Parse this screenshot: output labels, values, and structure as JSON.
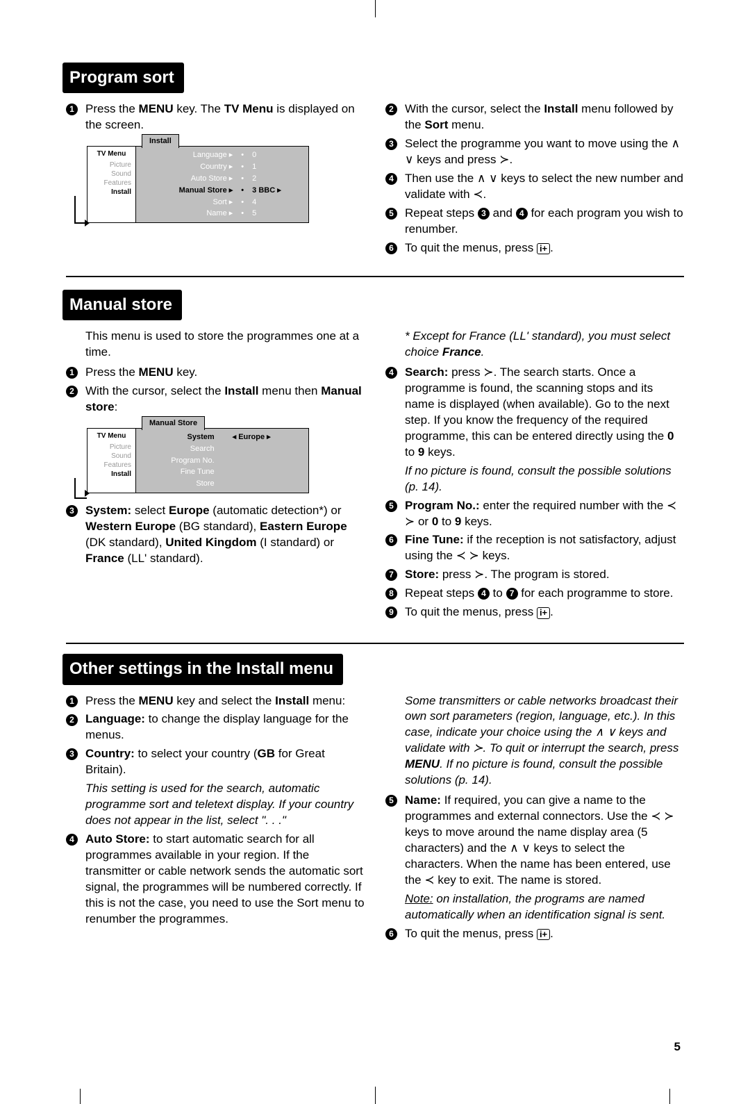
{
  "page_number": "5",
  "sections": {
    "program_sort": {
      "title": "Program sort",
      "col1": {
        "step1": "Press the <b>MENU</b> key. The <b>TV Menu</b> is displayed on the screen."
      },
      "diagram1": {
        "left_title": "TV Menu",
        "left_items": [
          "Picture",
          "Sound",
          "Features",
          "Install"
        ],
        "left_active_index": 3,
        "right_title": "Install",
        "rows": [
          {
            "label": "Language",
            "val": "0"
          },
          {
            "label": "Country",
            "val": "1"
          },
          {
            "label": "Auto Store",
            "val": "2"
          },
          {
            "label": "Manual Store",
            "val": "3  BBC  ▸",
            "active": true
          },
          {
            "label": "Sort",
            "val": "4"
          },
          {
            "label": "Name",
            "val": "5"
          }
        ]
      },
      "col2": {
        "step2": "With the cursor, select the <b>Install</b> menu followed by the <b>Sort</b> menu.",
        "step3": "Select the programme you want to move using the ∧ ∨ keys and press ≻.",
        "step4": "Then use the ∧ ∨ keys to select the new number and validate with ≺.",
        "step5i": "Repeat steps ",
        "step5m": " and ",
        "step5e": " for each program you wish to renumber.",
        "step6a": "To quit the menus, press ",
        "step6b": "."
      }
    },
    "manual_store": {
      "title": "Manual store",
      "intro": "This menu is used to store the programmes one at a time.",
      "col1": {
        "step1": "Press the <b>MENU</b> key.",
        "step2": "With the cursor, select the <b>Install</b> menu then <b>Manual store</b>:"
      },
      "diagram2": {
        "left_title": "TV Menu",
        "left_items": [
          "Picture",
          "Sound",
          "Features",
          "Install"
        ],
        "left_active_index": 3,
        "right_title": "Manual Store",
        "rows": [
          {
            "label": "System",
            "val": "◂  Europe  ▸",
            "active": true
          },
          {
            "label": "Search",
            "val": ""
          },
          {
            "label": "Program No.",
            "val": ""
          },
          {
            "label": "Fine Tune",
            "val": ""
          },
          {
            "label": "Store",
            "val": ""
          }
        ]
      },
      "step3": "<b>System:</b> select <b>Europe</b> (automatic detection*) or <b>Western Europe</b> (BG standard), <b>Eastern Europe</b> (DK standard), <b>United Kingdom</b> (I standard) or <b>France</b> (LL' standard).",
      "col2": {
        "note_star": "* Except for France (LL' standard), you must select choice <b>France</b>.",
        "step4": "<b>Search:</b> press ≻. The search starts. Once a programme is found, the scanning stops and its name is displayed (when available). Go to the next step. If you know the frequency of the required programme, this can be entered directly using the <b>0</b> to <b>9</b> keys.",
        "note4": "If no picture is found, consult the possible solutions (p. 14).",
        "step5": "<b>Program No.:</b> enter the required number with the ≺ ≻ or <b>0</b> to <b>9</b> keys.",
        "step6": "<b>Fine Tune:</b> if the reception is not satisfactory, adjust using the ≺ ≻ keys.",
        "step7": "<b>Store:</b> press ≻. The program is stored.",
        "step8a": "Repeat steps ",
        "step8b": " to ",
        "step8c": " for each programme to store.",
        "step9a": "To quit the menus, press ",
        "step9b": "."
      }
    },
    "other": {
      "title": "Other settings in the Install menu",
      "col1": {
        "step1": "Press the <b>MENU</b> key and select the <b>Install</b> menu:",
        "step2": "<b>Language:</b> to change the display language for the menus.",
        "step3": "<b>Country:</b> to select your country (<b>GB</b> for Great Britain).",
        "note3": "This setting is used for the search, automatic programme sort and teletext display. If your country does not appear in the list, select \". . .\"",
        "step4": "<b>Auto Store:</b> to start automatic search for all programmes available in your region. If the transmitter or cable network sends the automatic sort signal, the programmes will be numbered correctly. If this is not the case, you need to use the Sort menu to renumber the programmes."
      },
      "col2": {
        "note_top": "Some transmitters or cable networks broadcast their own sort parameters (region, language, etc.). In this case, indicate your choice using the ∧ ∨ keys and validate with ≻. To quit or interrupt the search, press <b>MENU</b>. If no picture is found, consult the possible solutions (p. 14).",
        "step5": "<b>Name:</b> If required, you can give a name to the programmes and external connectors. Use the ≺ ≻ keys to move around the name display area (5 characters) and the ∧ ∨ keys to select the characters. When the name has been entered, use the ≺ key to exit. The name is stored.",
        "note5": "<u>Note:</u> on installation, the programs are named automatically when an identification signal is sent.",
        "step6a": "To quit the menus, press ",
        "step6b": "."
      }
    }
  },
  "icon_label": "i+"
}
